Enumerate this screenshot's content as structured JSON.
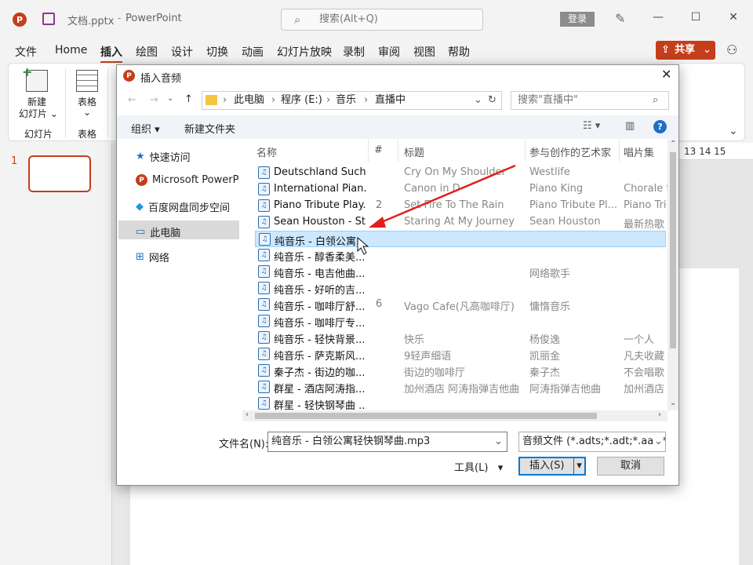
{
  "app": {
    "filename": "文档.pptx",
    "appname": "PowerPoint",
    "search_placeholder": "搜索(Alt+Q)",
    "login": "登录",
    "share": "共享"
  },
  "menu": [
    "文件",
    "Home",
    "插入",
    "绘图",
    "设计",
    "切换",
    "动画",
    "幻灯片放映",
    "录制",
    "审阅",
    "视图",
    "帮助"
  ],
  "ribbon": {
    "new_slide_line1": "新建",
    "new_slide_line2": "幻灯片",
    "table": "表格",
    "group_slides": "幻灯片",
    "group_table": "表格"
  },
  "slide_number": "1",
  "ruler_marks": "13 14 15",
  "dialog": {
    "title": "插入音频",
    "breadcrumb": [
      "此电脑",
      "程序 (E:)",
      "音乐",
      "直播中"
    ],
    "search_placeholder": "搜索\"直播中\"",
    "organize": "组织",
    "new_folder": "新建文件夹",
    "nav": [
      "快速访问",
      "Microsoft PowerPo",
      "百度网盘同步空间",
      "此电脑",
      "网络"
    ],
    "columns": [
      "名称",
      "#",
      "标题",
      "参与创作的艺术家",
      "唱片集"
    ],
    "files": [
      {
        "name": "Deutschland Such...",
        "num": "",
        "title": "Cry On My Shoulder",
        "artist": "Westlife",
        "album": ""
      },
      {
        "name": "International Pian...",
        "num": "",
        "title": "Canon in D",
        "artist": "Piano King",
        "album": "Chorale f"
      },
      {
        "name": "Piano Tribute Play...",
        "num": "2",
        "title": "Set Fire To The Rain",
        "artist": "Piano Tribute Pl...",
        "album": "Piano Tri"
      },
      {
        "name": "Sean Houston - St...",
        "num": "",
        "title": "Staring At My Journey",
        "artist": "Sean Houston",
        "album": "最新热歌"
      },
      {
        "name": "纯音乐 - 白领公寓...",
        "num": "",
        "title": "",
        "artist": "",
        "album": ""
      },
      {
        "name": "纯音乐 - 醇香柔美...",
        "num": "",
        "title": "",
        "artist": "",
        "album": ""
      },
      {
        "name": "纯音乐 - 电吉他曲...",
        "num": "",
        "title": "",
        "artist": "网络歌手",
        "album": ""
      },
      {
        "name": "纯音乐 - 好听的吉...",
        "num": "",
        "title": "",
        "artist": "",
        "album": ""
      },
      {
        "name": "纯音乐 - 咖啡厅舒...",
        "num": "6",
        "title": "Vago Cafe(凡高咖啡厅)",
        "artist": "慵惰音乐",
        "album": ""
      },
      {
        "name": "纯音乐 - 咖啡厅专...",
        "num": "",
        "title": "",
        "artist": "",
        "album": ""
      },
      {
        "name": "纯音乐 - 轻快背景...",
        "num": "",
        "title": "快乐",
        "artist": "杨俊逸",
        "album": "一个人"
      },
      {
        "name": "纯音乐 - 萨克斯风...",
        "num": "",
        "title": "9轻声细语",
        "artist": "凯丽金",
        "album": "凡夫收藏"
      },
      {
        "name": "秦子杰 - 街边的咖...",
        "num": "",
        "title": "街边的咖啡厅",
        "artist": "秦子杰",
        "album": "不会唱歌"
      },
      {
        "name": "群星 - 酒店阿涛指...",
        "num": "",
        "title": "加州酒店 阿涛指弹吉他曲",
        "artist": "阿涛指弹吉他曲",
        "album": "加州酒店"
      },
      {
        "name": "群星 - 轻快钢琴曲 ...",
        "num": "",
        "title": "",
        "artist": "",
        "album": ""
      }
    ],
    "filename_label": "文件名(N):",
    "filename_value": "纯音乐 - 白领公寓轻快钢琴曲.mp3",
    "filetype": "音频文件 (*.adts;*.adt;*.aac;*.a",
    "tools": "工具(L)",
    "insert": "插入(S)",
    "cancel": "取消"
  },
  "colors": {
    "accent": "#c43e1c",
    "selection": "#cce8ff",
    "arrow": "#e02020"
  }
}
